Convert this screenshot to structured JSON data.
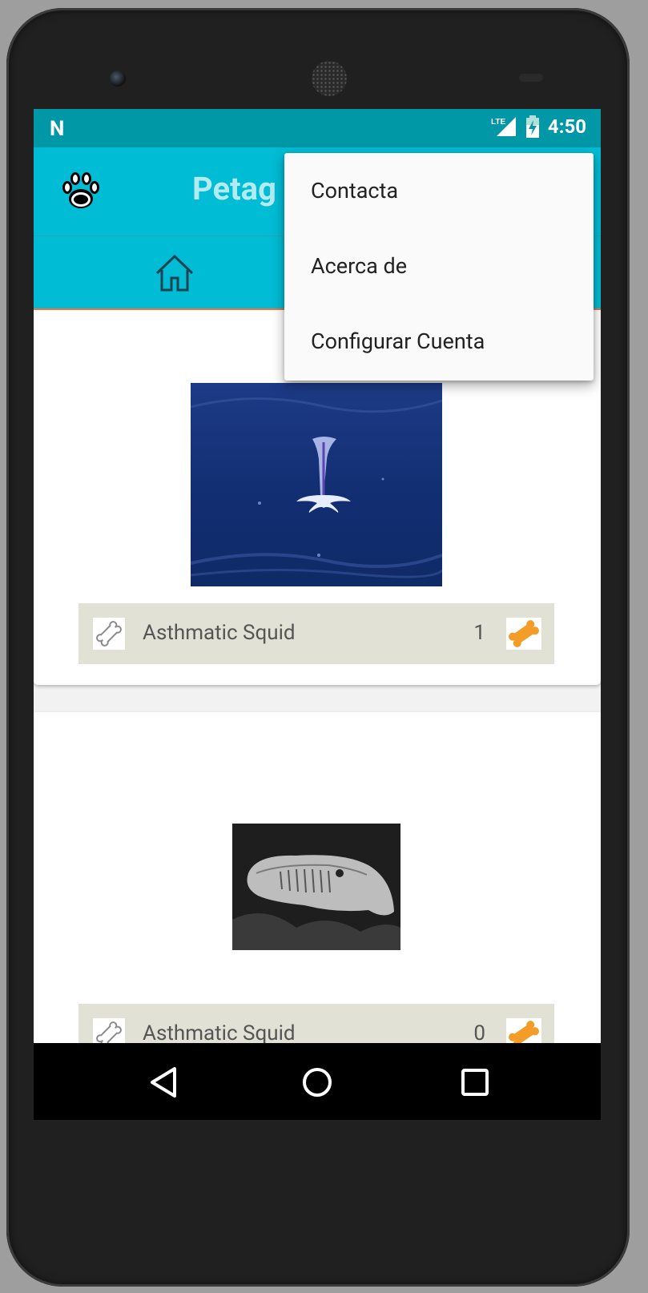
{
  "status_bar": {
    "logo": "N",
    "network": "LTE",
    "time": "4:50"
  },
  "app_bar": {
    "title": "Petag"
  },
  "overflow_menu": {
    "items": [
      "Contacta",
      "Acerca de",
      "Configurar Cuenta"
    ]
  },
  "pets": [
    {
      "name": "Asthmatic Squid",
      "rating": "1"
    },
    {
      "name": "Asthmatic Squid",
      "rating": "0"
    }
  ],
  "colors": {
    "primary": "#00bcd4",
    "primary_dark": "#0097a7",
    "accent": "#ff7043",
    "bar_bg": "#e1e1d5",
    "bone": "#f39c28"
  },
  "icons": [
    "paw-icon",
    "home-icon",
    "bone-outline-icon",
    "bone-filled-icon",
    "back-icon",
    "home-circle-icon",
    "recents-icon"
  ]
}
